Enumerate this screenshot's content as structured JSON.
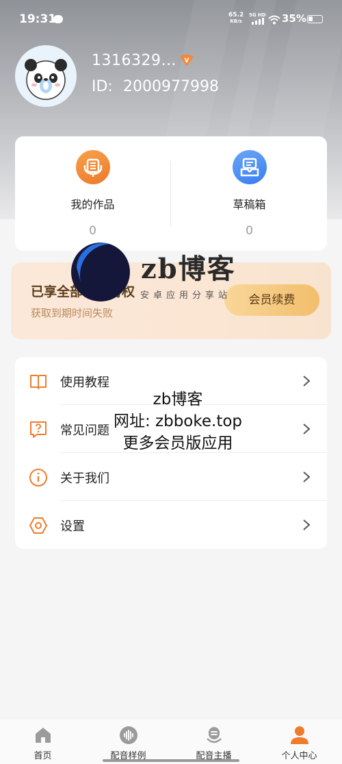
{
  "status_bar": {
    "time": "19:31",
    "speed_value": "65.2",
    "speed_unit": "KB/s",
    "network": "5G HD",
    "battery": "35%"
  },
  "profile": {
    "username": "1316329…",
    "id_label": "ID:",
    "id_value": "2000977998",
    "vip_badge_letter": "V"
  },
  "stats": [
    {
      "label": "我的作品",
      "count": "0",
      "icon": "microphone-icon",
      "color": "#f08a3a"
    },
    {
      "label": "草稿箱",
      "count": "0",
      "icon": "draft-box-icon",
      "color": "#4a8df2"
    }
  ],
  "vip_banner": {
    "title": "已享全部会员特权",
    "subtitle": "获取到期时间失败",
    "renew_button": "会员续费"
  },
  "menu": [
    {
      "label": "使用教程",
      "icon": "book-icon"
    },
    {
      "label": "常见问题",
      "icon": "question-icon"
    },
    {
      "label": "关于我们",
      "icon": "info-icon"
    },
    {
      "label": "设置",
      "icon": "settings-hexagon-icon"
    }
  ],
  "watermark": {
    "brand": "zb博客",
    "tagline": "安卓应用分享站",
    "lines": [
      "zb博客",
      "网址: zbboke.top",
      "更多会员版应用"
    ]
  },
  "bottom_nav": [
    {
      "label": "首页",
      "icon": "home-icon",
      "active": false
    },
    {
      "label": "配音样例",
      "icon": "audio-wave-icon",
      "active": false
    },
    {
      "label": "配音主播",
      "icon": "anchor-mic-icon",
      "active": false
    },
    {
      "label": "个人中心",
      "icon": "person-icon",
      "active": true
    }
  ],
  "colors": {
    "accent": "#f07b2a",
    "draft_blue": "#4a8df2",
    "vip_text": "#5b3d1b",
    "vip_sub": "#b9895a"
  }
}
